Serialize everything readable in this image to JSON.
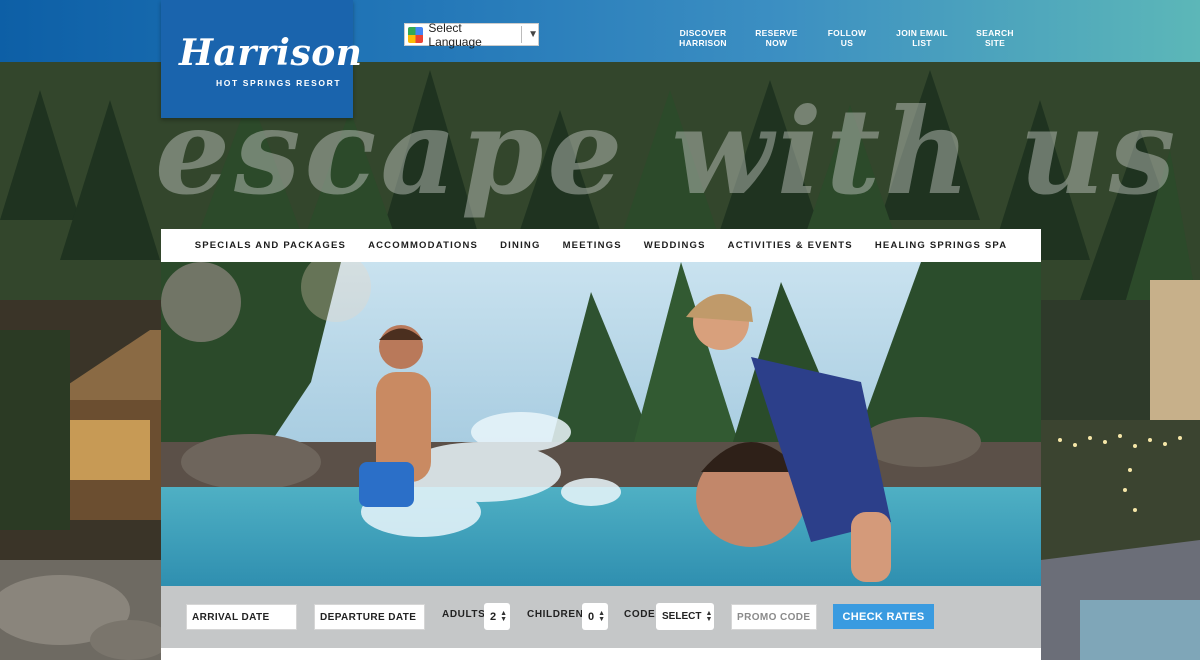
{
  "brand": {
    "name": "Harrison",
    "subtitle": "HOT SPRINGS RESORT"
  },
  "language": {
    "label": "Select Language",
    "icon": "google-translate-icon"
  },
  "topnav": [
    {
      "line1": "DISCOVER",
      "line2": "HARRISON"
    },
    {
      "line1": "RESERVE",
      "line2": "NOW"
    },
    {
      "line1": "FOLLOW",
      "line2": "US"
    },
    {
      "line1": "JOIN EMAIL",
      "line2": "LIST"
    },
    {
      "line1": "SEARCH",
      "line2": "SITE"
    }
  ],
  "tagline": "escape with us",
  "mainnav": [
    "SPECIALS AND PACKAGES",
    "ACCOMMODATIONS",
    "DINING",
    "MEETINGS",
    "WEDDINGS",
    "ACTIVITIES & EVENTS",
    "HEALING SPRINGS SPA"
  ],
  "booking": {
    "arrival_placeholder": "ARRIVAL DATE",
    "departure_placeholder": "DEPARTURE DATE",
    "adults_label": "ADULTS",
    "adults_value": "2",
    "children_label": "CHILDREN",
    "children_value": "0",
    "code_label": "CODE",
    "code_value": "SELECT",
    "promo_placeholder": "PROMO CODE",
    "check_rates": "CHECK RATES"
  },
  "colors": {
    "topbar_start": "#0d5fa6",
    "topbar_end": "#5cb7b8",
    "logo_bg": "#1a64ad",
    "button": "#3a9be0"
  }
}
